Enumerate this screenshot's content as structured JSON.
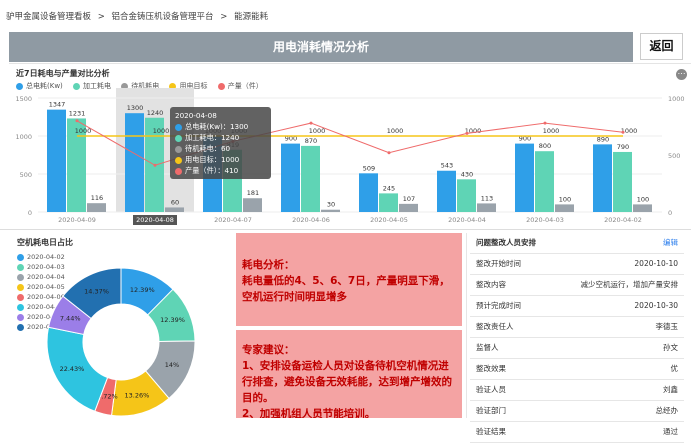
{
  "breadcrumb": [
    "驴甲金属设备管理看板",
    ">",
    "铝合金铸压机设备管理平台",
    ">",
    "能源能耗"
  ],
  "header": {
    "title": "用电消耗情况分析",
    "back_label": "返回"
  },
  "energy_chart": {
    "title": "近7日耗电与产量对比分析",
    "legend": [
      {
        "name": "总电耗(Kw)",
        "color": "#2f9fe8"
      },
      {
        "name": "加工耗电",
        "color": "#5fd4b5"
      },
      {
        "name": "待机耗电",
        "color": "#999999"
      },
      {
        "name": "用电目标",
        "color": "#f5c518"
      },
      {
        "name": "产量（件）",
        "color": "#ef6b6b"
      }
    ],
    "tooltip": {
      "date": "2020-04-08",
      "rows": [
        {
          "label": "总电耗(Kw)：",
          "value": "1300",
          "color": "#2f9fe8"
        },
        {
          "label": "加工耗电：",
          "value": "1240",
          "color": "#5fd4b5"
        },
        {
          "label": "待机耗电：",
          "value": "60",
          "color": "#999999"
        },
        {
          "label": "用电目标：",
          "value": "1000",
          "color": "#f5c518"
        },
        {
          "label": "产量（件）：",
          "value": "410",
          "color": "#ef6b6b"
        }
      ]
    },
    "selected_date": "2020-04-08"
  },
  "chart_data": {
    "type": "bar",
    "categories": [
      "2020-04-09",
      "2020-04-08",
      "2020-04-07",
      "2020-04-06",
      "2020-04-05",
      "2020-04-04",
      "2020-04-03",
      "2020-04-02"
    ],
    "series": [
      {
        "name": "总电耗(Kw)",
        "type": "bar",
        "values": [
          1347,
          1300,
          1000,
          900,
          509,
          543,
          900,
          890
        ]
      },
      {
        "name": "加工耗电",
        "type": "bar",
        "values": [
          1231,
          1240,
          819,
          870,
          245,
          430,
          800,
          790
        ]
      },
      {
        "name": "待机耗电",
        "type": "bar",
        "values": [
          116,
          60,
          181,
          30,
          107,
          113,
          100,
          100
        ]
      },
      {
        "name": "用电目标",
        "type": "line",
        "values": [
          1000,
          1000,
          1000,
          1000,
          1000,
          1000,
          1000,
          1000
        ]
      },
      {
        "name": "产量（件）",
        "type": "line",
        "values": [
          800,
          410,
          620,
          780,
          520,
          690,
          780,
          700
        ]
      }
    ],
    "ylim": [
      0,
      1500
    ],
    "yticks": [
      0,
      500,
      1000,
      1500
    ],
    "y2ticks": [
      0,
      500,
      1000
    ],
    "grid": true,
    "legend_position": "top-left"
  },
  "pie": {
    "title": "空机耗电日占比",
    "items": [
      {
        "date": "2020-04-02",
        "percent": "12.39%",
        "color": "#2f9fe8"
      },
      {
        "date": "2020-04-03",
        "percent": "12.39%",
        "color": "#5fd4b5"
      },
      {
        "date": "2020-04-04",
        "percent": "14%",
        "color": "#9aa3ab"
      },
      {
        "date": "2020-04-05",
        "percent": "13.26%",
        "color": "#f5c518"
      },
      {
        "date": "2020-04-06",
        "percent": "3.72%",
        "color": "#ef6b6b"
      },
      {
        "date": "2020-04-07",
        "percent": "22.43%",
        "color": "#2ec4e0"
      },
      {
        "date": "2020-04-08",
        "percent": "7.44%",
        "color": "#9b7ee8"
      },
      {
        "date": "2020-04-09",
        "percent": "14.37%",
        "color": "#2270b0"
      }
    ]
  },
  "analysis": {
    "heading": "耗电分析：",
    "text": "耗电量低的4、5、6、7日，产量明显下滑，空机运行时间明显增多"
  },
  "advice": {
    "heading": "专家建议：",
    "item1": "1、安排设备运检人员对设备待机空机情况进行排查，避免设备无效耗能，达到增产增效的目的。",
    "item2": "2、加强机组人员节能培训。"
  },
  "issue_table": {
    "title": "问题整改人员安排",
    "edit_label": "编辑",
    "rows": [
      {
        "key": "整改开始时间",
        "value": "2020-10-10"
      },
      {
        "key": "整改内容",
        "value": "减少空机运行，增加产量安排"
      },
      {
        "key": "预计完成时间",
        "value": "2020-10-30"
      },
      {
        "key": "整改责任人",
        "value": "李德玉"
      },
      {
        "key": "监督人",
        "value": "孙文"
      },
      {
        "key": "整改效果",
        "value": "优"
      },
      {
        "key": "验证人员",
        "value": "刘鑫"
      },
      {
        "key": "验证部门",
        "value": "总经办"
      },
      {
        "key": "验证结果",
        "value": "通过"
      }
    ]
  }
}
